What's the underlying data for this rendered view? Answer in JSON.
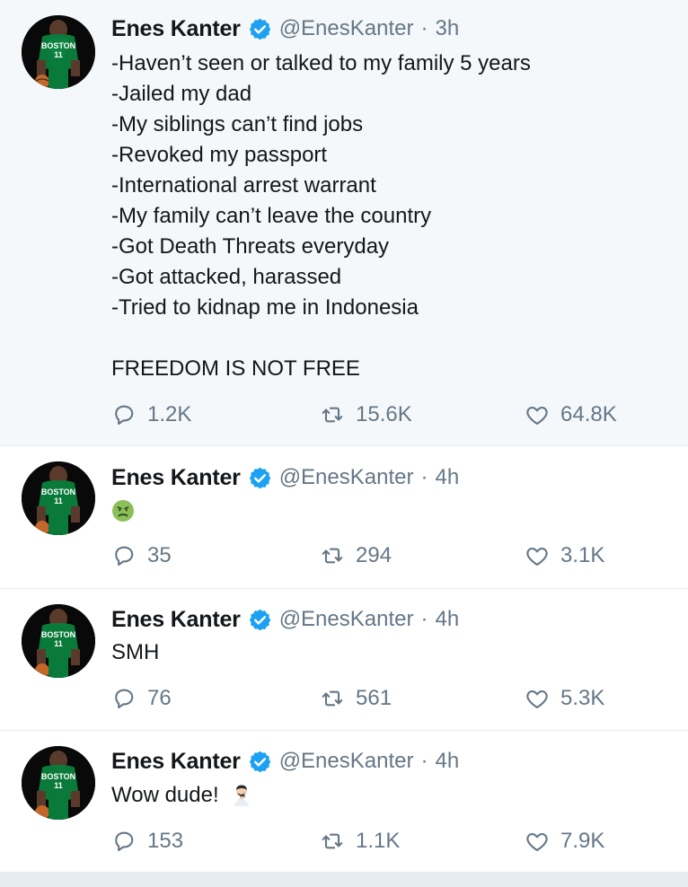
{
  "tweets": [
    {
      "author": {
        "name": "Enes Kanter",
        "handle": "@EnesKanter",
        "verified": true,
        "avatar": "basketball-player-avatar"
      },
      "time": "3h",
      "separator": "·",
      "text_lines": [
        "-Haven’t seen or talked to my family 5 years",
        "-Jailed my dad",
        "-My siblings can’t find jobs",
        "-Revoked my passport",
        "-International arrest warrant",
        "-My family can’t leave the country",
        "-Got Death Threats everyday",
        "-Got attacked, harassed",
        "-Tried to kidnap me in Indonesia",
        "",
        "FREEDOM IS NOT FREE"
      ],
      "actions": {
        "replies": "1.2K",
        "retweets": "15.6K",
        "likes": "64.8K"
      }
    },
    {
      "author": {
        "name": "Enes Kanter",
        "handle": "@EnesKanter",
        "verified": true,
        "avatar": "basketball-player-avatar"
      },
      "time": "4h",
      "separator": "·",
      "emoji": "nauseated-face",
      "actions": {
        "replies": "35",
        "retweets": "294",
        "likes": "3.1K"
      }
    },
    {
      "author": {
        "name": "Enes Kanter",
        "handle": "@EnesKanter",
        "verified": true,
        "avatar": "basketball-player-avatar"
      },
      "time": "4h",
      "separator": "·",
      "text": "SMH",
      "actions": {
        "replies": "76",
        "retweets": "561",
        "likes": "5.3K"
      }
    },
    {
      "author": {
        "name": "Enes Kanter",
        "handle": "@EnesKanter",
        "verified": true,
        "avatar": "basketball-player-avatar"
      },
      "time": "4h",
      "separator": "·",
      "text": "Wow dude!",
      "emoji": "man-facepalming",
      "actions": {
        "replies": "153",
        "retweets": "1.1K",
        "likes": "7.9K"
      }
    }
  ],
  "colors": {
    "primary_text": "#14171a",
    "secondary_text": "#657786",
    "verified_blue": "#1da1f2",
    "highlight_background": "#f5f8fa",
    "divider": "#e6ecf0",
    "jersey_green": "#0a7a3a"
  },
  "icons": {
    "reply": "reply-bubble-icon",
    "retweet": "retweet-icon",
    "like": "heart-icon",
    "verified": "verified-badge-icon"
  }
}
